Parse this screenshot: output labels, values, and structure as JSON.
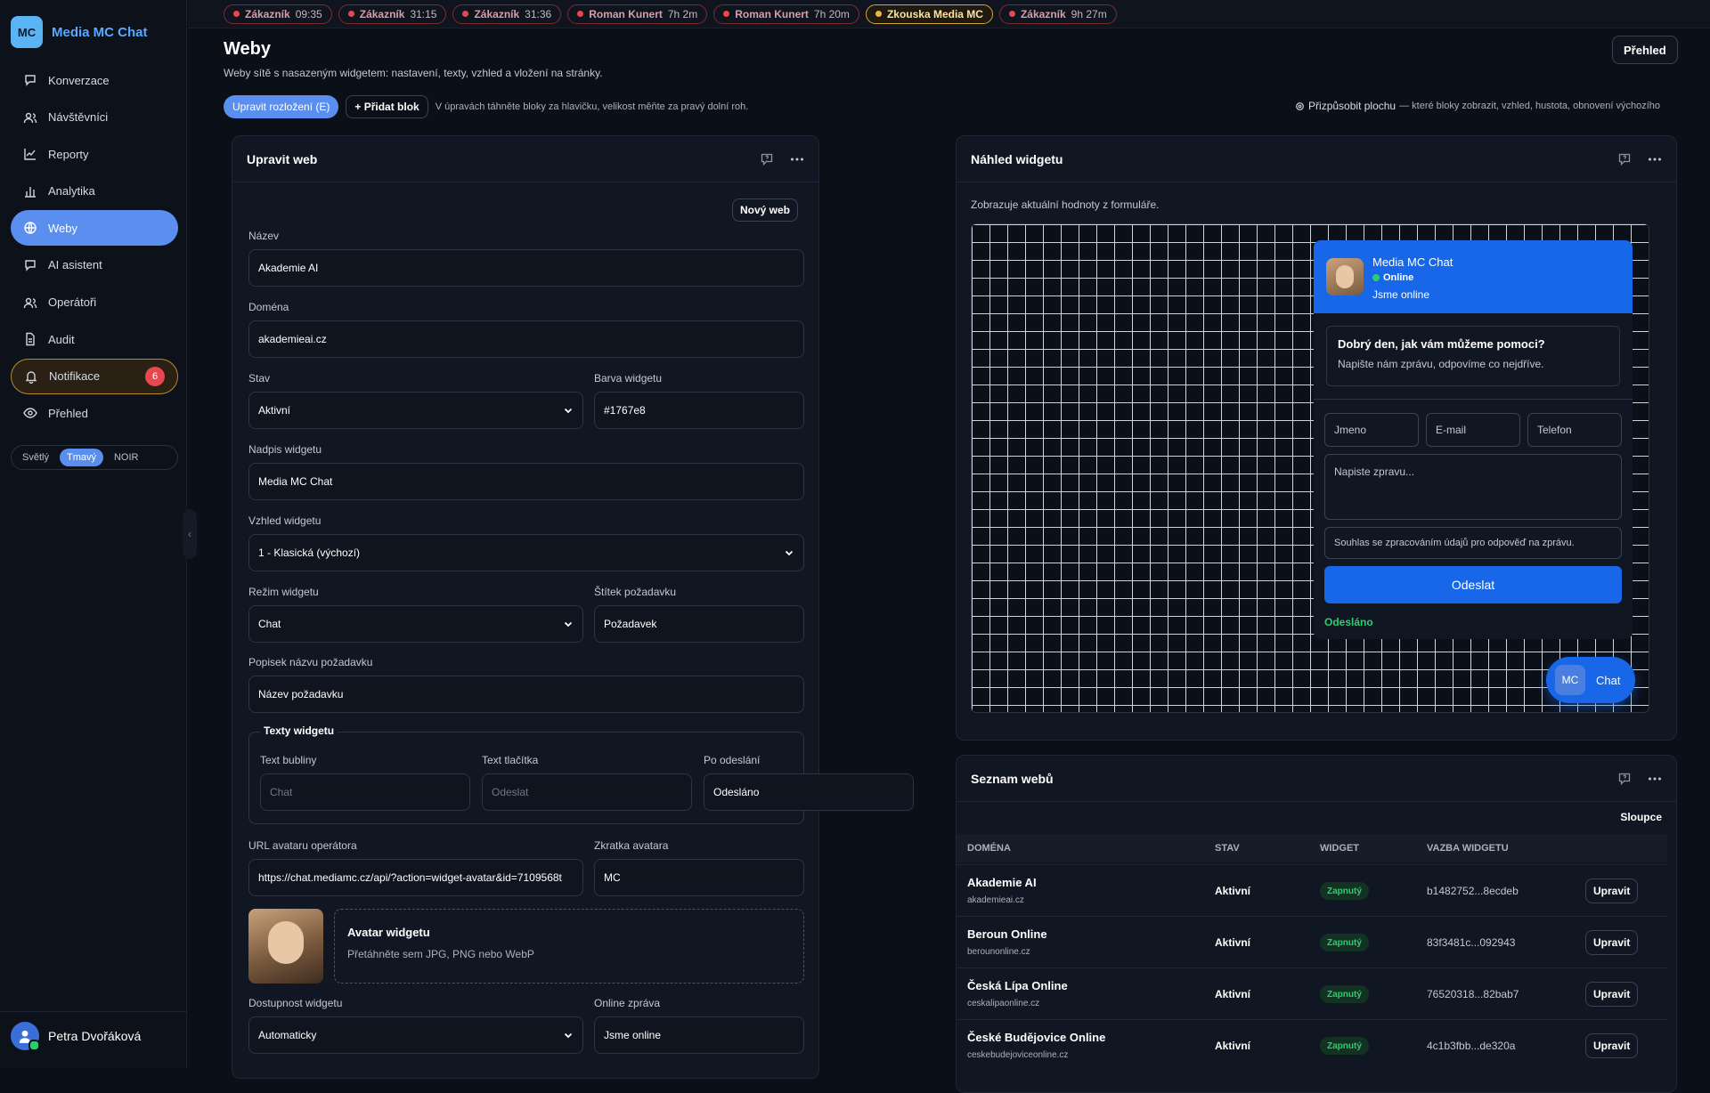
{
  "app": {
    "logo": "MC",
    "name": "Media MC Chat"
  },
  "sidebar": {
    "items": [
      {
        "label": "Konverzace",
        "icon": "chat-bubble-icon"
      },
      {
        "label": "Návštěvníci",
        "icon": "users-icon"
      },
      {
        "label": "Reporty",
        "icon": "line-chart-icon"
      },
      {
        "label": "Analytika",
        "icon": "bar-chart-icon"
      },
      {
        "label": "Weby",
        "icon": "globe-icon",
        "active": true
      },
      {
        "label": "AI asistent",
        "icon": "chat-bubble-icon"
      },
      {
        "label": "Operátoři",
        "icon": "users-icon"
      },
      {
        "label": "Audit",
        "icon": "document-icon"
      },
      {
        "label": "Notifikace",
        "icon": "bell-icon",
        "badge": "6"
      },
      {
        "label": "Přehled",
        "icon": "eye-icon"
      }
    ],
    "theme": {
      "options": [
        "Světlý",
        "Tmavý",
        "NOIR"
      ],
      "selected": "Tmavý"
    },
    "user": {
      "name": "Petra Dvořáková"
    },
    "collapse_icon": "‹"
  },
  "tabs": [
    {
      "label": "Zákazník",
      "time": "09:35"
    },
    {
      "label": "Zákazník",
      "time": "31:15"
    },
    {
      "label": "Zákazník",
      "time": "31:36"
    },
    {
      "label": "Roman Kunert",
      "time": "7h 2m"
    },
    {
      "label": "Roman Kunert",
      "time": "7h 20m"
    },
    {
      "label": "Zkouska Media MC",
      "time": "",
      "highlight": true
    },
    {
      "label": "Zákazník",
      "time": "9h 27m"
    }
  ],
  "page": {
    "title": "Weby",
    "subtitle": "Weby sítě s nasazeným widgetem: nastavení, texty, vzhled a vložení na stránky.",
    "overview_button": "Přehled",
    "edit_layout_button": "Upravit rozložení (E)",
    "add_block_button": "+ Přidat blok",
    "layout_hint": "V úpravách táhněte bloky za hlavičku, velikost měňte za pravý dolní roh.",
    "customize_label": "Přizpůsobit plochu",
    "customize_hint": "— které bloky zobrazit, vzhled, hustota, obnovení výchozího"
  },
  "edit_form": {
    "title": "Upravit web",
    "new_button": "Nový web",
    "name_label": "Název",
    "name_value": "Akademie AI",
    "domain_label": "Doména",
    "domain_value": "akademieai.cz",
    "status_label": "Stav",
    "status_value": "Aktivní",
    "color_label": "Barva widgetu",
    "color_value": "#1767e8",
    "heading_label": "Nadpis widgetu",
    "heading_value": "Media MC Chat",
    "look_label": "Vzhled widgetu",
    "look_value": "1 - Klasická (výchozí)",
    "mode_label": "Režim widgetu",
    "mode_value": "Chat",
    "tag_label": "Štítek požadavku",
    "tag_value": "Požadavek",
    "req_label": "Popisek názvu požadavku",
    "req_value": "Název požadavku",
    "texts_legend": "Texty widgetu",
    "bubble_label": "Text bubliny",
    "bubble_placeholder": "Chat",
    "button_label": "Text tlačítka",
    "button_placeholder": "Odeslat",
    "after_label": "Po odeslání",
    "after_value": "Odesláno",
    "avatar_url_label": "URL avataru operátora",
    "avatar_url_value": "https://chat.mediamc.cz/api/?action=widget-avatar&id=7109568t",
    "avatar_short_label": "Zkratka avatara",
    "avatar_short_value": "MC",
    "avatar_drop_title": "Avatar widgetu",
    "avatar_drop_hint": "Přetáhněte sem JPG, PNG nebo WebP",
    "availability_label": "Dostupnost widgetu",
    "availability_value": "Automaticky",
    "online_label": "Online zpráva",
    "online_value": "Jsme online"
  },
  "preview": {
    "title": "Náhled widgetu",
    "hint": "Zobrazuje aktuální hodnoty z formuláře.",
    "widget": {
      "name": "Media MC Chat",
      "status": "Online",
      "message": "Jsme online",
      "greeting_title": "Dobrý den, jak vám můžeme pomoci?",
      "greeting_text": "Napište nám zprávu, odpovíme co nejdříve.",
      "name_placeholder": "Jmeno",
      "email_placeholder": "E-mail",
      "phone_placeholder": "Telefon",
      "message_placeholder": "Napiste zpravu...",
      "consent": "Souhlas se zpracováním údajů pro odpověď na zprávu.",
      "send": "Odeslat",
      "sent": "Odesláno",
      "bubble_avatar": "MC",
      "bubble_text": "Chat",
      "accent": "#1767e8"
    }
  },
  "sites": {
    "title": "Seznam webů",
    "columns_button": "Sloupce",
    "headers": [
      "DOMÉNA",
      "STAV",
      "WIDGET",
      "VAZBA WIDGETU"
    ],
    "rows": [
      {
        "name": "Akademie AI",
        "domain": "akademieai.cz",
        "status": "Aktivní",
        "widget": "Zapnutý",
        "hash": "b1482752...8ecdeb",
        "action": "Upravit"
      },
      {
        "name": "Beroun Online",
        "domain": "berounonline.cz",
        "status": "Aktivní",
        "widget": "Zapnutý",
        "hash": "83f3481c...092943",
        "action": "Upravit"
      },
      {
        "name": "Česká Lípa Online",
        "domain": "ceskalipaonline.cz",
        "status": "Aktivní",
        "widget": "Zapnutý",
        "hash": "76520318...82bab7",
        "action": "Upravit"
      },
      {
        "name": "České Budějovice Online",
        "domain": "ceskebudejoviceonline.cz",
        "status": "Aktivní",
        "widget": "Zapnutý",
        "hash": "4c1b3fbb...de320a",
        "action": "Upravit"
      }
    ]
  }
}
